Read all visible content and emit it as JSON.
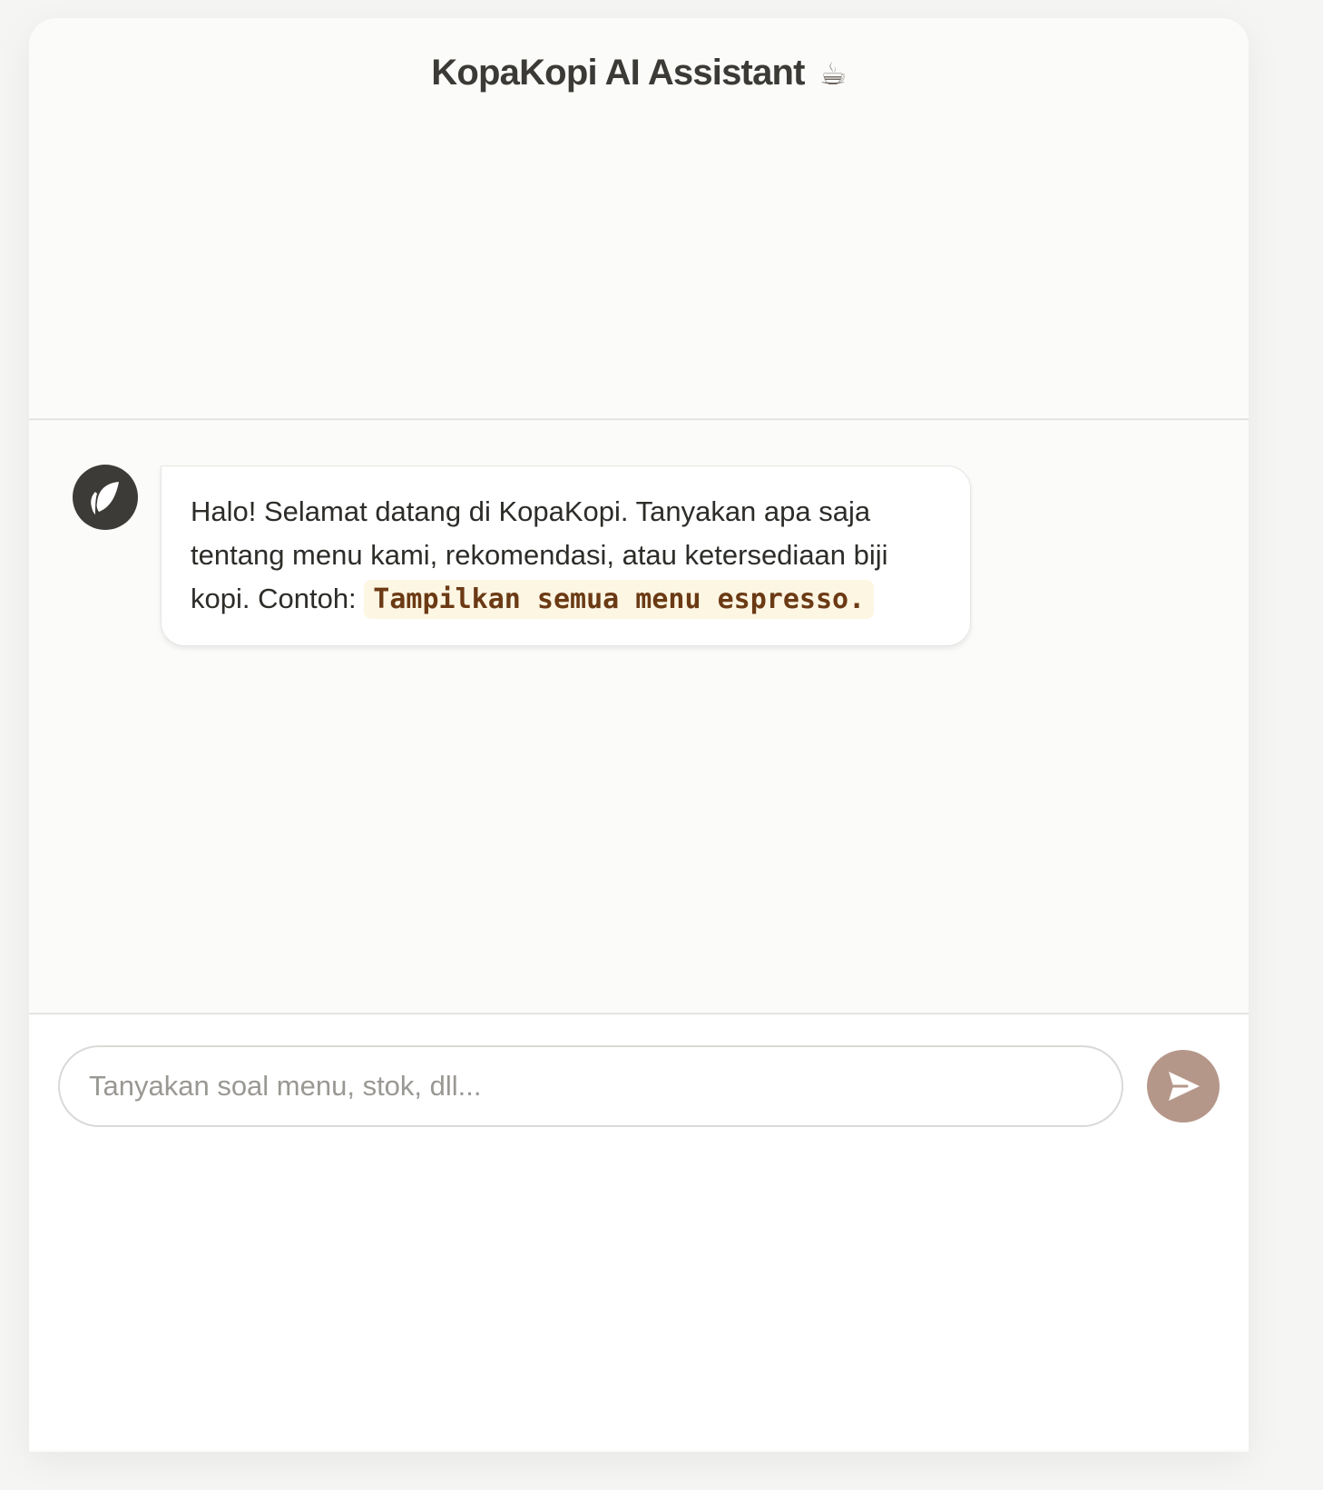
{
  "header": {
    "title": "KopaKopi AI Assistant",
    "title_emoji": "☕"
  },
  "messages": [
    {
      "sender": "assistant",
      "avatar_icon": "leaf-icon",
      "text": "Halo! Selamat datang di KopaKopi. Tanyakan apa saja tentang menu kami, rekomendasi, atau ketersediaan biji kopi. Contoh: ",
      "code": "Tampilkan semua menu espresso."
    }
  ],
  "composer": {
    "placeholder": "Tanyakan soal menu, stok, dll...",
    "value": "",
    "send_icon": "send-icon"
  },
  "colors": {
    "background": "#f5f5f3",
    "card": "#fbfbfa",
    "avatar": "#3d3b37",
    "send_button": "#b5978a",
    "code_text": "#6b3a14",
    "code_background": "#fdf6e3"
  }
}
